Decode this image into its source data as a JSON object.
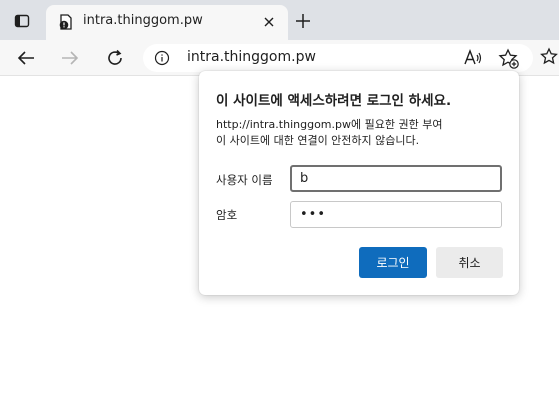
{
  "browser": {
    "tab": {
      "title": "intra.thinggom.pw",
      "favicon": "globe-warning-icon"
    },
    "address_bar": {
      "url": "intra.thinggom.pw",
      "site_info_icon": "info-circle-icon"
    },
    "toolbar_icons": [
      "back-arrow-icon",
      "forward-arrow-icon",
      "refresh-icon",
      "read-aloud-icon",
      "add-favorite-icon",
      "favorites-icon"
    ]
  },
  "auth_dialog": {
    "title": "이 사이트에 액세스하려면 로그인 하세요.",
    "description_line1": "http://intra.thinggom.pw에 필요한 권한 부여",
    "description_line2": "이 사이트에 대한 연결이 안전하지 않습니다.",
    "username_label": "사용자 이름",
    "username_value": "b",
    "password_label": "암호",
    "password_value": "•••",
    "login_button": "로그인",
    "cancel_button": "취소",
    "colors": {
      "primary": "#0f6cbd",
      "secondary": "#ebebeb"
    }
  }
}
